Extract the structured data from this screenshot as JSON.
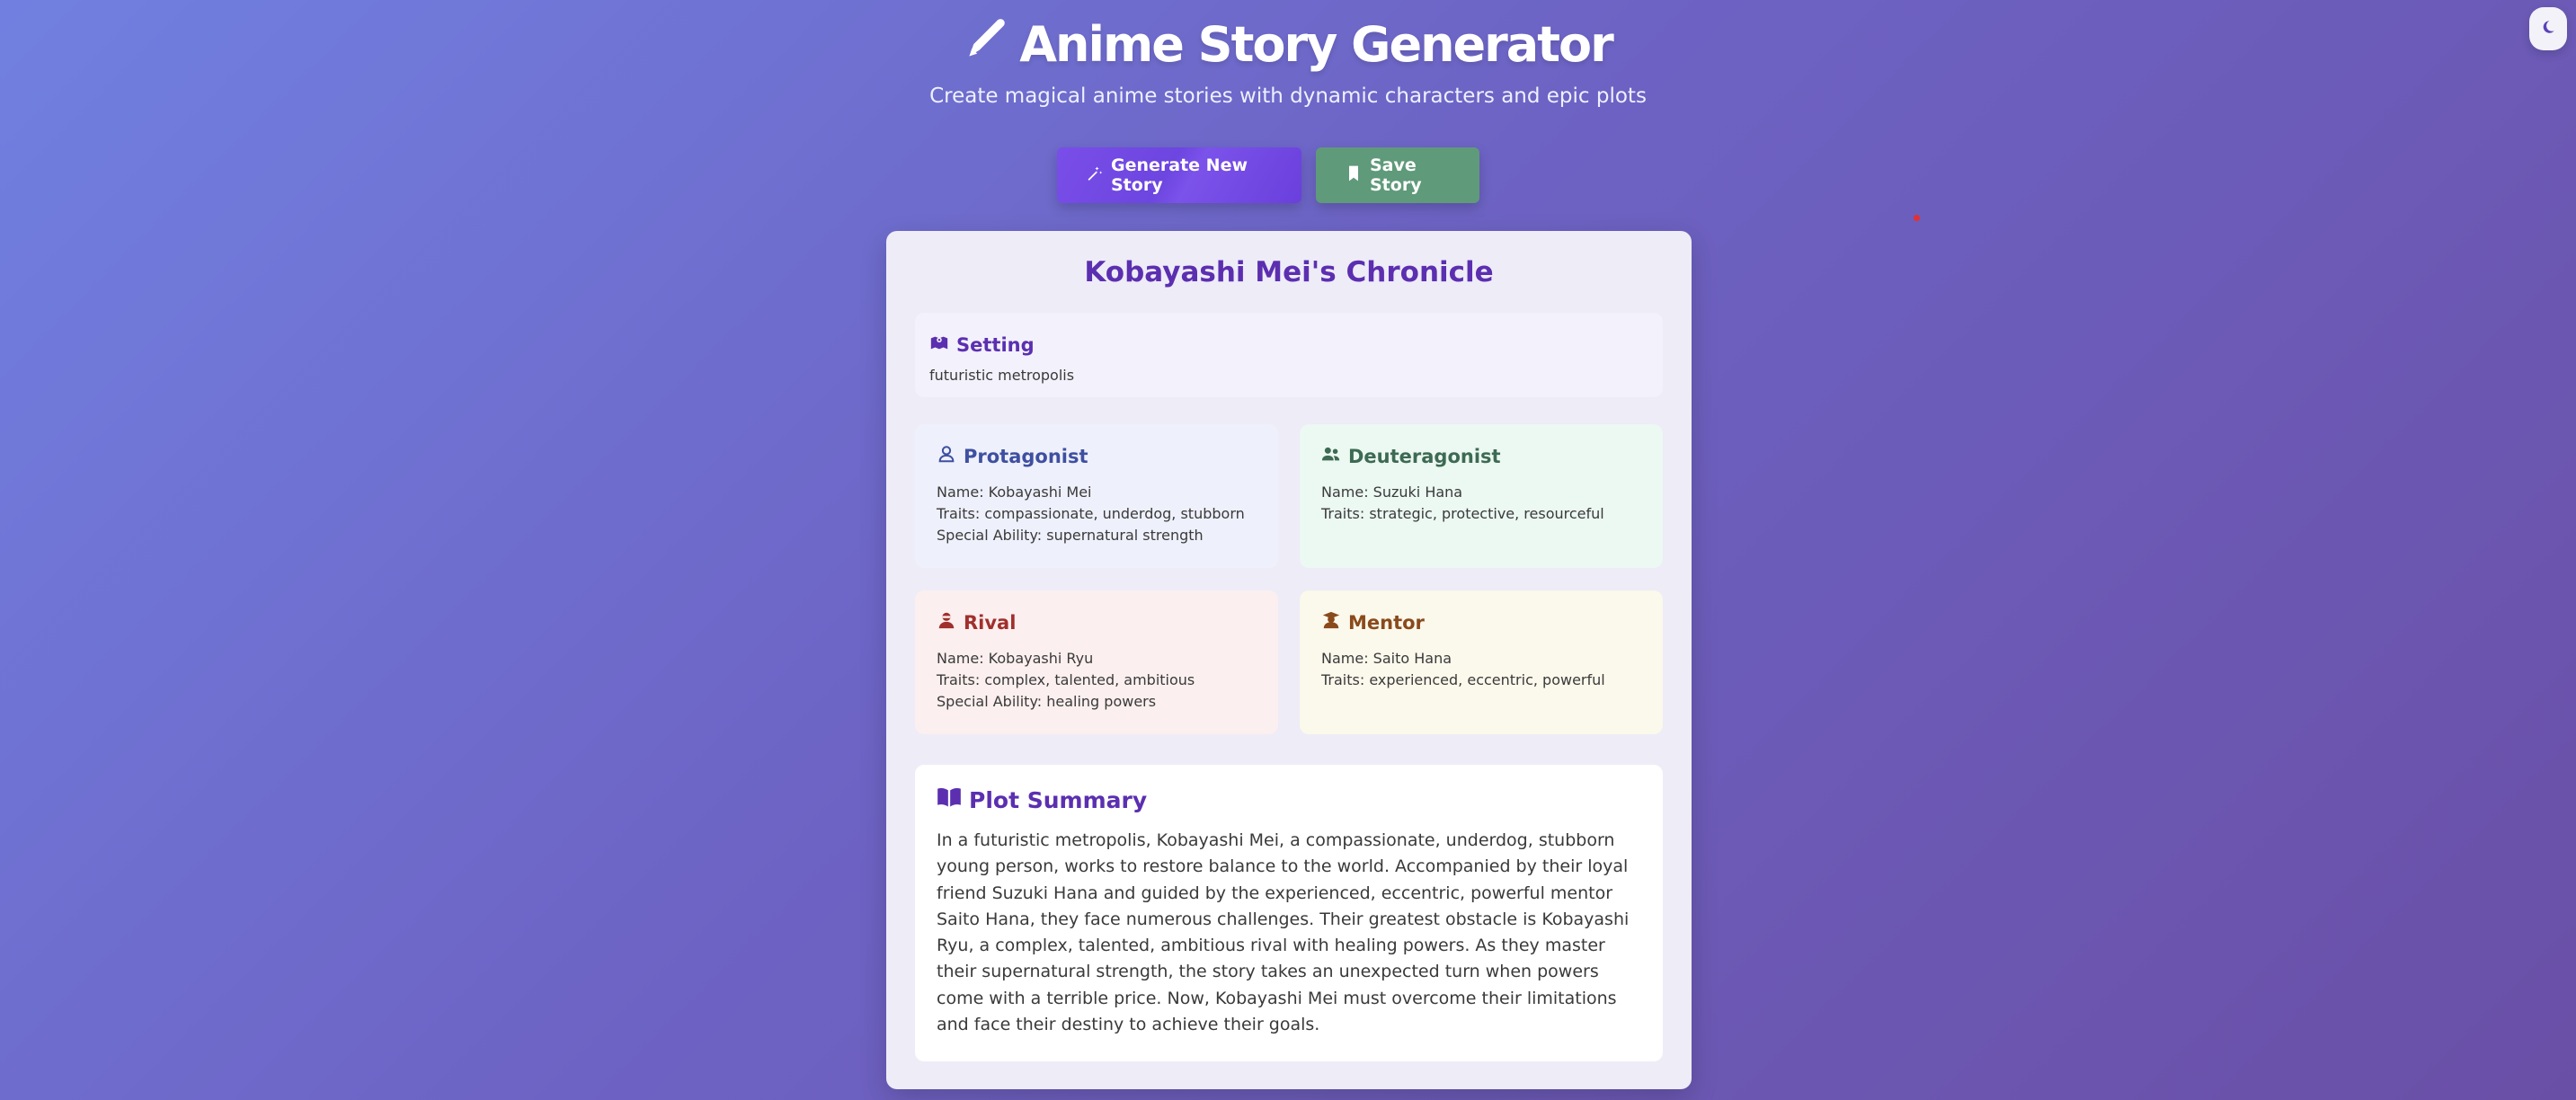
{
  "header": {
    "title": "Anime Story Generator",
    "subtitle": "Create magical anime stories with dynamic characters and epic plots",
    "title_icon": "pen-icon"
  },
  "theme_toggle": {
    "icon": "moon-icon"
  },
  "actions": {
    "generate_label": "Generate New Story",
    "generate_icon": "magic-wand-icon",
    "save_label": "Save Story",
    "save_icon": "bookmark-icon"
  },
  "story": {
    "title": "Kobayashi Mei's Chronicle",
    "setting": {
      "heading": "Setting",
      "icon": "map-icon",
      "value": "futuristic metropolis"
    },
    "characters": {
      "protagonist": {
        "heading": "Protagonist",
        "icon": "user-icon",
        "lines": [
          "Name: Kobayashi Mei",
          "Traits: compassionate, underdog, stubborn",
          "Special Ability: supernatural strength"
        ]
      },
      "deuteragonist": {
        "heading": "Deuteragonist",
        "icon": "users-icon",
        "lines": [
          "Name: Suzuki Hana",
          "Traits: strategic, protective, resourceful"
        ]
      },
      "rival": {
        "heading": "Rival",
        "icon": "user-ninja-icon",
        "lines": [
          "Name: Kobayashi Ryu",
          "Traits: complex, talented, ambitious",
          "Special Ability: healing powers"
        ]
      },
      "mentor": {
        "heading": "Mentor",
        "icon": "user-graduate-icon",
        "lines": [
          "Name: Saito Hana",
          "Traits: experienced, eccentric, powerful"
        ]
      }
    },
    "plot": {
      "heading": "Plot Summary",
      "icon": "book-open-icon",
      "text": "In a futuristic metropolis, Kobayashi Mei, a compassionate, underdog, stubborn young person, works to restore balance to the world. Accompanied by their loyal friend Suzuki Hana and guided by the experienced, eccentric, powerful mentor Saito Hana, they face numerous challenges. Their greatest obstacle is Kobayashi Ryu, a complex, talented, ambitious rival with healing powers. As they master their supernatural strength, the story takes an unexpected turn when powers come with a terrible price. Now, Kobayashi Mei must overcome their limitations and face their destiny to achieve their goals."
    }
  },
  "colors": {
    "background_start": "#7180e0",
    "background_end": "#6a4fa6",
    "accent_purple": "#5b2fb0",
    "generate_button": "#7a4ee8",
    "save_button": "#5f9a7a"
  }
}
